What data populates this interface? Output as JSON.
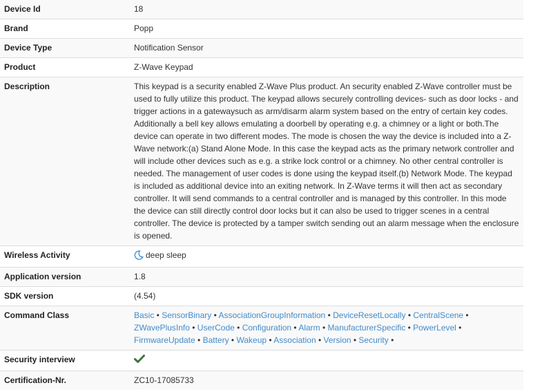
{
  "rows": {
    "device_id": {
      "label": "Device Id",
      "value": "18"
    },
    "brand": {
      "label": "Brand",
      "value": "Popp"
    },
    "device_type": {
      "label": "Device Type",
      "value": "Notification Sensor"
    },
    "product": {
      "label": "Product",
      "value": "Z-Wave Keypad"
    },
    "description": {
      "label": "Description",
      "value": "This keypad is a security enabled Z-Wave Plus product. An security enabled Z-Wave controller must be used to fully utilize this product. The keypad allows securely controlling devices- such as door locks - and trigger actions in a gatewaysuch as arm/disarm alarm system based on the entry of certain key codes. Additionally a bell key allows emulating a doorbell by operating e.g. a chimney or a light or both.The device can operate in two different modes. The mode is chosen the way the device is included into a Z-Wave network:(a) Stand Alone Mode. In this case the keypad acts as the primary network controller and will include other devices such as e.g. a strike lock control or a chimney. No other central controller is needed. The management of user codes is done using the keypad itself.(b) Network Mode. The keypad is included as additional device into an exiting network. In Z-Wave terms it will then act as secondary controller. It will send commands to a central controller and is managed by this controller. In this mode the device can still directly control door locks but it can also be used to trigger scenes in a central controller. The device is protected by a tamper switch sending out an alarm message when the enclosure is opened."
    },
    "wireless_activity": {
      "label": "Wireless Activity",
      "value": "deep sleep",
      "icon": "moon-icon"
    },
    "application_version": {
      "label": "Application version",
      "value": "1.8"
    },
    "sdk_version": {
      "label": "SDK version",
      "value": "(4.54)"
    },
    "command_class": {
      "label": "Command Class"
    },
    "security_interview": {
      "label": "Security interview",
      "icon": "checkmark-icon",
      "icon_color": "#3c763d"
    },
    "certification": {
      "label": "Certification-Nr.",
      "value": "ZC10-17085733"
    }
  },
  "command_classes": [
    "Basic",
    "SensorBinary",
    "AssociationGroupInformation",
    "DeviceResetLocally",
    "CentralScene",
    "ZWavePlusInfo",
    "UserCode",
    "Configuration",
    "Alarm",
    "ManufacturerSpecific",
    "PowerLevel",
    "FirmwareUpdate",
    "Battery",
    "Wakeup",
    "Association",
    "Version",
    "Security"
  ],
  "colors": {
    "link": "#428bca",
    "stripe": "#f9f9f9",
    "border": "#dddddd"
  }
}
